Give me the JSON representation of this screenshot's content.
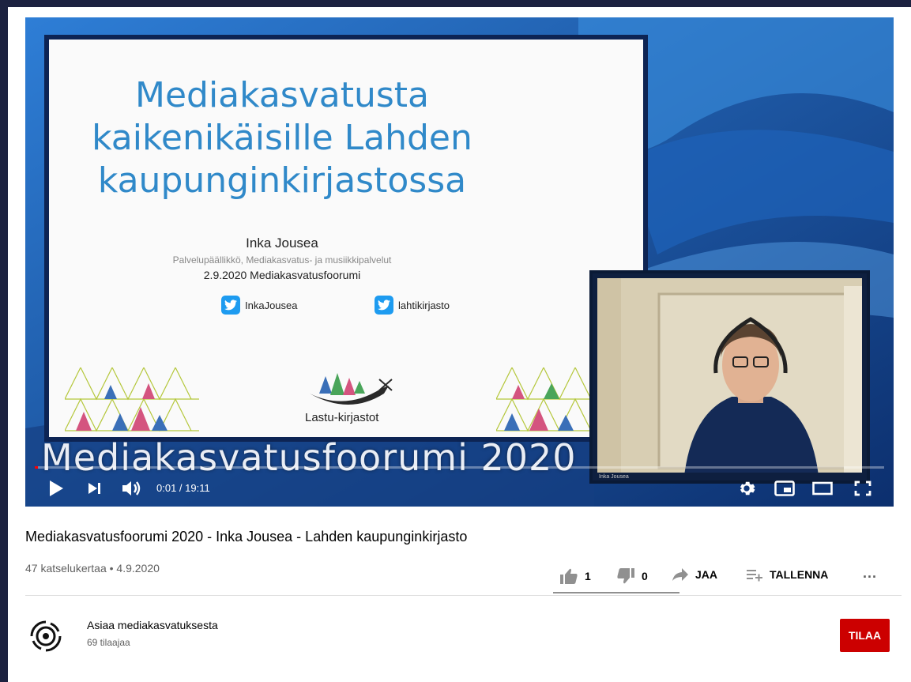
{
  "video": {
    "slide_title_lines": [
      "Mediakasvatusta",
      "kaikenikäisille Lahden",
      "kaupunginkirjastossa"
    ],
    "slide_speaker": "Inka Jousea",
    "slide_role": "Palvelupäällikkö, Mediakasvatus- ja musiikkipalvelut",
    "slide_date": "2.9.2020 Mediakasvatusfoorumi",
    "slide_twitter_1": "InkaJousea",
    "slide_twitter_2": "lahtikirjasto",
    "slide_logo_text": "Lastu-kirjastot",
    "overlay_title": "Mediakasvatusfoorumi 2020",
    "cam_label": "Inka Jousea",
    "time_display": "0:01 / 19:11",
    "progress_fraction": 0.001
  },
  "info": {
    "title": "Mediakasvatusfoorumi 2020 - Inka Jousea - Lahden kaupunginkirjasto",
    "meta": "47 katselukertaa • 4.9.2020",
    "likes": "1",
    "dislikes": "0",
    "share_label": "JAA",
    "save_label": "TALLENNA",
    "more_label": "..."
  },
  "channel": {
    "name": "Asiaa mediakasvatuksesta",
    "subscribers": "69 tilaajaa",
    "subscribe_label": "TILAA"
  },
  "colors": {
    "page_bg": "#1c2240",
    "subscribe": "#cc0000",
    "slide_title": "#3089c9"
  }
}
